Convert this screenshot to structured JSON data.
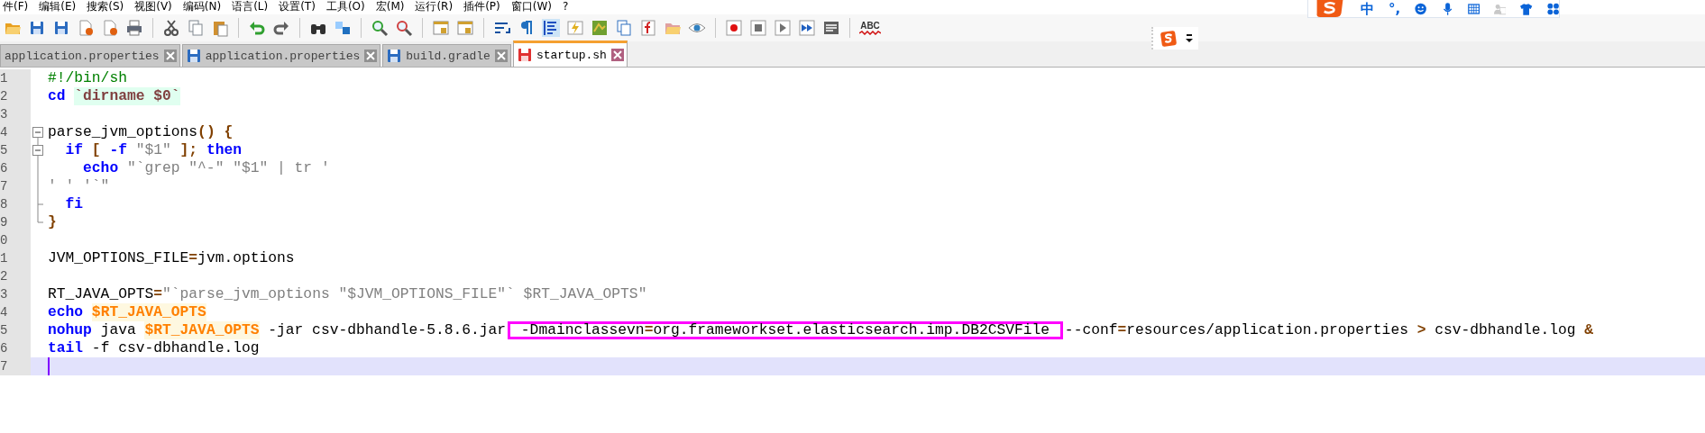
{
  "menu": [
    "件(F)",
    "编辑(E)",
    "搜索(S)",
    "视图(V)",
    "编码(N)",
    "语言(L)",
    "设置(T)",
    "工具(O)",
    "宏(M)",
    "运行(R)",
    "插件(P)",
    "窗口(W)",
    "?"
  ],
  "toolbar": {
    "spellcheck_label": "ABC"
  },
  "ime": {
    "mode": "中",
    "punctuation": "°,"
  },
  "tabs": [
    {
      "label": "application.properties",
      "selected": false
    },
    {
      "label": "application.properties",
      "selected": false,
      "modified": false
    },
    {
      "label": "build.gradle",
      "selected": false,
      "modified": false
    },
    {
      "label": "startup.sh",
      "selected": true,
      "modified": true
    }
  ],
  "editor": {
    "lines": [
      {
        "number": "1",
        "current": false,
        "tokens": [
          {
            "kind": "comment",
            "text": "#!/bin/sh"
          }
        ]
      },
      {
        "number": "2",
        "current": false,
        "tokens": [
          {
            "kind": "keyword",
            "text": "cd "
          },
          {
            "kind": "backtick",
            "text": "`dirname $0`"
          }
        ]
      },
      {
        "number": "3",
        "current": false
      },
      {
        "number": "4",
        "fold": {
          "kind": "open"
        },
        "current": false,
        "tokens": [
          {
            "kind": "plain",
            "text": "parse_jvm_options"
          },
          {
            "kind": "operator",
            "text": "() {"
          }
        ]
      },
      {
        "number": "5",
        "fold": {
          "kind": "open_nested"
        },
        "current": false,
        "tokens": [
          {
            "kind": "keyword",
            "text": "  if"
          },
          {
            "kind": "operator",
            "text": " [ "
          },
          {
            "kind": "keyword",
            "text": "-f "
          },
          {
            "kind": "string",
            "text": "\"$1\""
          },
          {
            "kind": "operator",
            "text": " ]; "
          },
          {
            "kind": "keyword",
            "text": "then"
          }
        ]
      },
      {
        "number": "6",
        "fold": {
          "kind": "line"
        },
        "current": false,
        "tokens": [
          {
            "kind": "keyword",
            "text": "    echo "
          },
          {
            "kind": "string",
            "text": "\"`grep \"^-\" \"$1\" | tr '"
          }
        ]
      },
      {
        "number": "7",
        "fold": {
          "kind": "line"
        },
        "current": false,
        "tokens": [
          {
            "kind": "string",
            "text": "' ' '`\""
          }
        ]
      },
      {
        "number": "8",
        "fold": {
          "kind": "nested_end"
        },
        "current": false,
        "tokens": [
          {
            "kind": "keyword",
            "text": "  fi"
          }
        ]
      },
      {
        "number": "9",
        "fold": {
          "kind": "end"
        },
        "current": false,
        "tokens": [
          {
            "kind": "operator",
            "text": "}"
          }
        ]
      },
      {
        "number": "0",
        "current": false
      },
      {
        "number": "1",
        "current": false,
        "tokens": [
          {
            "kind": "plain",
            "text": "JVM_OPTIONS_FILE"
          },
          {
            "kind": "operator",
            "text": "="
          },
          {
            "kind": "plain",
            "text": "jvm.options"
          }
        ]
      },
      {
        "number": "2",
        "current": false
      },
      {
        "number": "3",
        "current": false,
        "tokens": [
          {
            "kind": "plain",
            "text": "RT_JAVA_OPTS"
          },
          {
            "kind": "operator",
            "text": "="
          },
          {
            "kind": "string",
            "text": "\"`parse_jvm_options \"$JVM_OPTIONS_FILE\"` $RT_JAVA_OPTS\""
          }
        ]
      },
      {
        "number": "4",
        "current": false,
        "tokens": [
          {
            "kind": "keyword",
            "text": "echo "
          },
          {
            "kind": "variable",
            "text": "$RT_JAVA_OPTS"
          }
        ]
      },
      {
        "number": "5",
        "current": false,
        "tokens": [
          {
            "kind": "keyword",
            "text": "nohup"
          },
          {
            "kind": "plain",
            "text": " java "
          },
          {
            "kind": "variable",
            "text": "$RT_JAVA_OPTS"
          },
          {
            "kind": "plain",
            "text": " -jar csv-dbhandle-5.8.6.jar"
          },
          {
            "kind": "annotation",
            "tokens": [
              {
                "kind": "plain",
                "text": " -Dmainclassevn"
              },
              {
                "kind": "operator",
                "text": "="
              },
              {
                "kind": "plain",
                "text": "org.frameworkset.elasticsearch.imp.DB2CSVFile "
              }
            ]
          },
          {
            "kind": "plain",
            "text": "--conf"
          },
          {
            "kind": "operator",
            "text": "="
          },
          {
            "kind": "plain",
            "text": "resources/application.properties "
          },
          {
            "kind": "operator",
            "text": ">"
          },
          {
            "kind": "plain",
            "text": " csv-dbhandle.log "
          },
          {
            "kind": "operator",
            "text": "&"
          }
        ]
      },
      {
        "number": "6",
        "current": false,
        "tokens": [
          {
            "kind": "keyword",
            "text": "tail"
          },
          {
            "kind": "plain",
            "text": " -f csv-dbhandle.log"
          }
        ]
      },
      {
        "number": "7",
        "current": true
      }
    ]
  }
}
